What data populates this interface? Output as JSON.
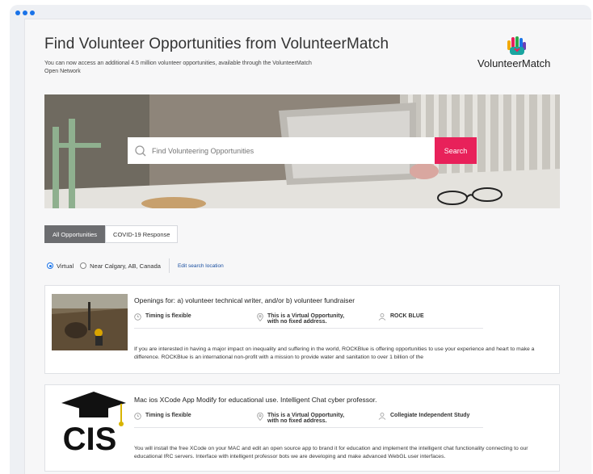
{
  "page": {
    "title": "Find Volunteer Opportunities from VolunteerMatch",
    "subtitle": "You can now access an additional 4.5 million volunteer opportunities, available through the VolunteerMatch Open Network",
    "logo_text": "VolunteerMatch"
  },
  "search": {
    "placeholder": "Find Volunteering Opportunities",
    "button_label": "Search"
  },
  "tabs": [
    {
      "label": "All Opportunities",
      "active": true
    },
    {
      "label": "COVID-19 Response",
      "active": false
    }
  ],
  "filters": {
    "virtual_label": "Virtual",
    "near_label": "Near Calgary, AB, Canada",
    "edit_location_label": "Edit search location"
  },
  "opportunities": [
    {
      "title": "Openings for: a) volunteer technical writer, and/or b) volunteer fundraiser",
      "timing": "Timing is flexible",
      "location_line1": "This is a Virtual Opportunity,",
      "location_line2": "with no fixed address.",
      "organization": "ROCK BLUE",
      "description": "If you are interested in having a major impact on inequality and suffering in the world, ROCKBlue is offering opportunities to use your experience and heart to make a difference. ROCKBlue is an international non-profit with a mission to provide water and sanitation to over 1 billion of the"
    },
    {
      "title": "Mac ios XCode App Modify for educational use. Intelligent Chat cyber professor.",
      "timing": "Timing is flexible",
      "location_line1": "This is a Virtual Opportunity,",
      "location_line2": "with no fixed address.",
      "organization": "Collegiate Independent Study",
      "thumb_text": "CIS",
      "description": "You will install the free XCode on your MAC and edit an open source app to brand it for education and implement the intelligent chat functionality connecting to our educational IRC servers. Interface with intelligent professor bots we are developing and make advanced WebGL user interfaces."
    }
  ],
  "colors": {
    "accent": "#e8215a",
    "link": "#1a4fa0",
    "active_tab": "#6c6d70"
  }
}
